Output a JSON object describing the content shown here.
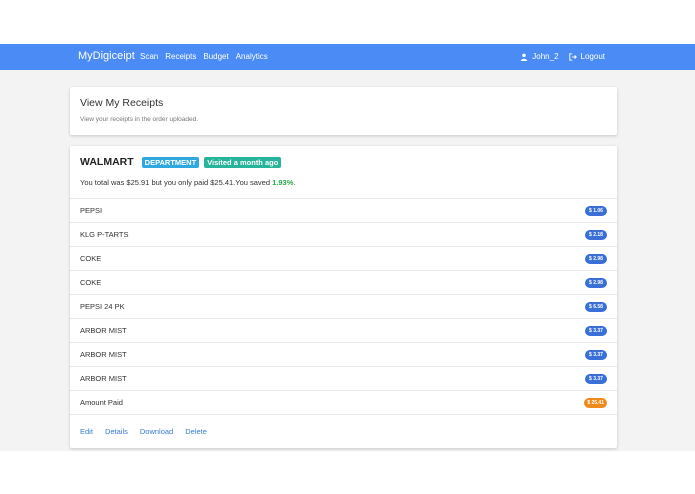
{
  "navbar": {
    "brand": "MyDigiceipt",
    "links": [
      "Scan",
      "Receipts",
      "Budget",
      "Analytics"
    ],
    "user": "John_2",
    "logout": "Logout",
    "color": "#4a8bf5"
  },
  "header": {
    "title": "View My Receipts",
    "subtitle": "View your receipts in the order uploaded."
  },
  "receipt": {
    "store": "WALMART",
    "category_tag": "DEPARTMENT",
    "visited_tag": "Visited a month ago",
    "summary_prefix": "You total was $25.91 but you only paid $25.41.You saved ",
    "saved_pct": "1.93%",
    "summary_suffix": ".",
    "items": [
      {
        "name": "PEPSI",
        "price": "$ 1.06"
      },
      {
        "name": "KLG P-TARTS",
        "price": "$ 2.18"
      },
      {
        "name": "COKE",
        "price": "$ 2.98"
      },
      {
        "name": "COKE",
        "price": "$ 2.98"
      },
      {
        "name": "PEPSI 24 PK",
        "price": "$ 6.58"
      },
      {
        "name": "ARBOR MIST",
        "price": "$ 3.37"
      },
      {
        "name": "ARBOR MIST",
        "price": "$ 3.37"
      },
      {
        "name": "ARBOR MIST",
        "price": "$ 3.37"
      },
      {
        "name": "Amount Paid",
        "price": "$ 25.41"
      }
    ],
    "actions": [
      "Edit",
      "Details",
      "Download",
      "Delete"
    ]
  },
  "colors": {
    "accent": "#4a8bf5",
    "department": "#2ea8df",
    "visited": "#26b49a",
    "price": "#3a6fd8",
    "total": "#f08a1c",
    "saved": "#2aa849"
  }
}
